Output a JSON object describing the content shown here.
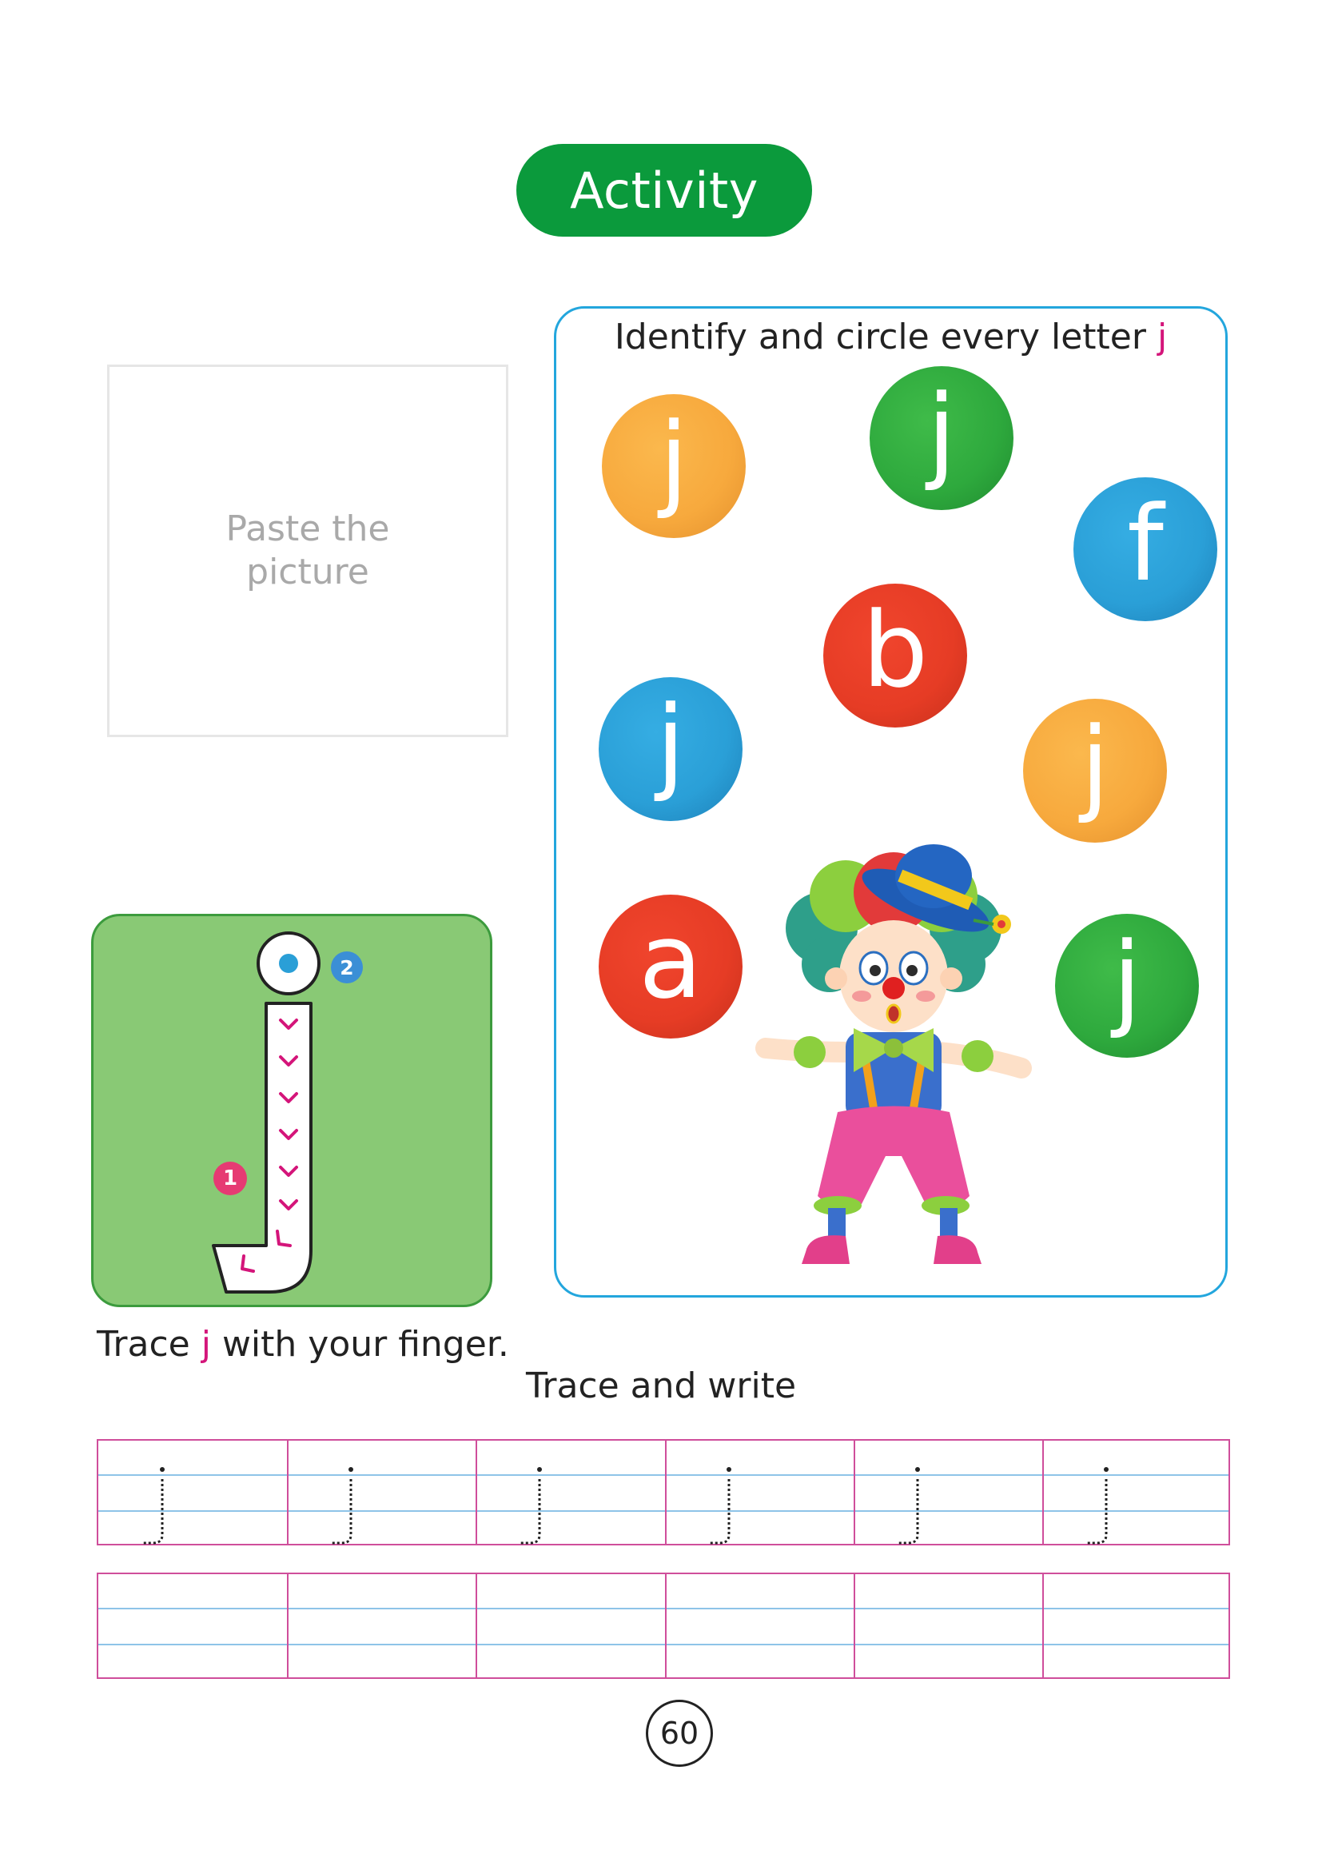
{
  "header": {
    "title": "Activity"
  },
  "paste_box": {
    "line1": "Paste the",
    "line2": "picture"
  },
  "circle_activity": {
    "instruction": "Identify and circle every letter ",
    "target_letter": "j",
    "balls": [
      {
        "letter": "j",
        "color": "orange"
      },
      {
        "letter": "j",
        "color": "green"
      },
      {
        "letter": "f",
        "color": "blue"
      },
      {
        "letter": "b",
        "color": "red"
      },
      {
        "letter": "j",
        "color": "blue"
      },
      {
        "letter": "j",
        "color": "orange"
      },
      {
        "letter": "a",
        "color": "red"
      },
      {
        "letter": "j",
        "color": "green"
      }
    ]
  },
  "trace_finger": {
    "step1": "1",
    "step2": "2",
    "caption_before": "Trace ",
    "caption_letter": "j",
    "caption_after": " with your finger."
  },
  "trace_write": {
    "title": "Trace and write",
    "letter": "j"
  },
  "footer": {
    "page_number": "60"
  },
  "colors": {
    "pill_green": "#0b9a3c",
    "panel_blue": "#23a6dd",
    "accent_pink": "#d4157a",
    "trace_bg": "#89c975"
  }
}
